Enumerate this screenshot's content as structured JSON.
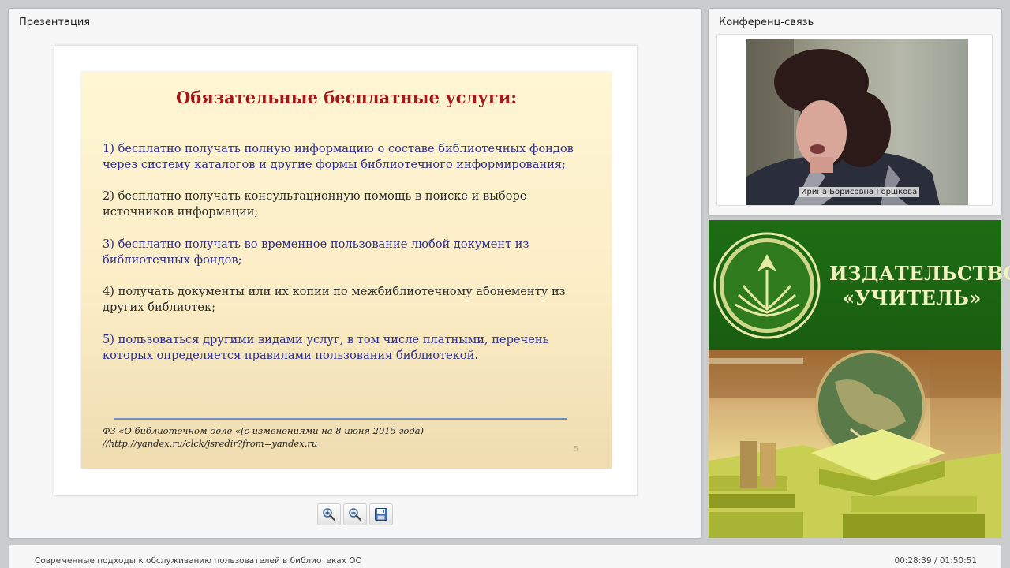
{
  "presentation_panel": {
    "title": "Презентация"
  },
  "slide": {
    "title": "Обязательные бесплатные услуги:",
    "items": [
      "1) бесплатно получать полную информацию о составе библиотечных фондов через систему каталогов и другие формы библиотечного информирования;",
      "2) бесплатно получать консультационную помощь в поиске и выборе источников информации;",
      "3) бесплатно получать во временное пользование любой документ из библиотечных фондов;",
      "4) получать документы или их копии по межбиблиотечному абонементу из других библиотек;",
      "5) пользоваться другими видами услуг, в том числе платными, перечень которых определяется правилами пользования библиотекой."
    ],
    "reference_line1": "ФЗ «О библиотечном деле «(с изменениями на 8 июня 2015 года)",
    "reference_line2": "//http://yandex.ru/clck/jsredir?from=yandex.ru",
    "page_number": "5",
    "colors": {
      "title": "#a01a1a",
      "blue_text": "#2d2f8c",
      "dark_text": "#2a2a2a"
    }
  },
  "toolbar": {
    "buttons": [
      "zoom-in-icon",
      "zoom-out-icon",
      "save-icon"
    ]
  },
  "conference_panel": {
    "title": "Конференц-связь",
    "participant_name": "Ирина Борисовна Горшкова"
  },
  "publisher": {
    "line1": "ИЗДАТЕЛЬСТВО",
    "line2": "«УЧИТЕЛЬ»",
    "colors": {
      "background": "#1d6d14",
      "text": "#f2f2c0"
    }
  },
  "footer": {
    "title": "Современные подходы к обслуживанию пользователей в библиотеках ОО",
    "time": "00:28:39 / 01:50:51"
  }
}
